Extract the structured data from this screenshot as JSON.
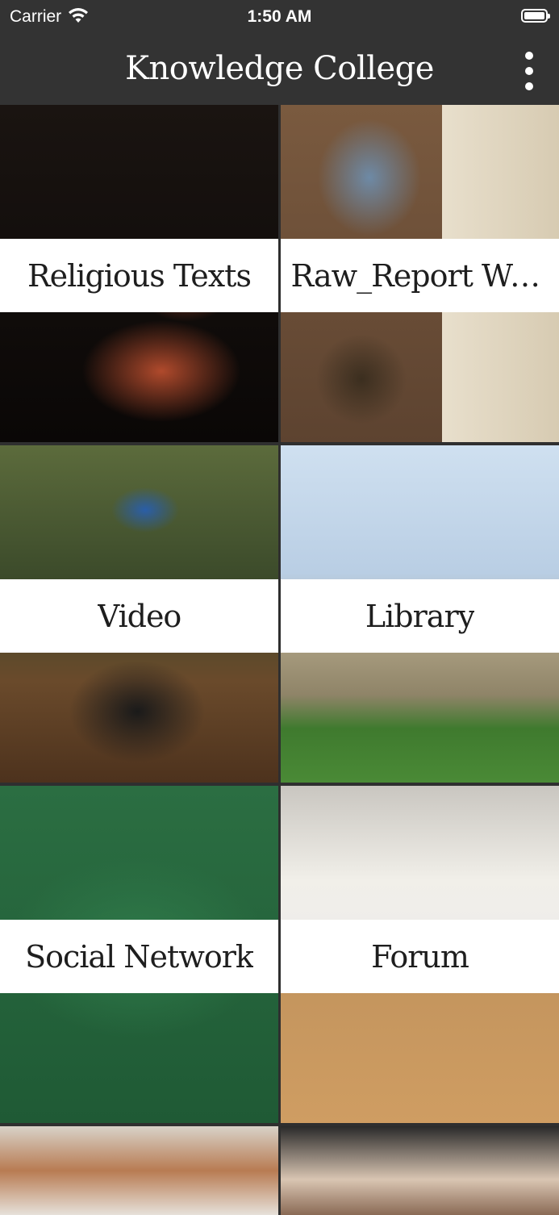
{
  "status_bar": {
    "carrier": "Carrier",
    "time": "1:50 AM"
  },
  "nav": {
    "title": "Knowledge College",
    "more_icon": "more-vertical-icon"
  },
  "tiles": [
    {
      "label": "Religious Texts"
    },
    {
      "label": "Raw_Report We..."
    },
    {
      "label": "Video"
    },
    {
      "label": "Library"
    },
    {
      "label": "Social Network"
    },
    {
      "label": "Forum"
    }
  ]
}
